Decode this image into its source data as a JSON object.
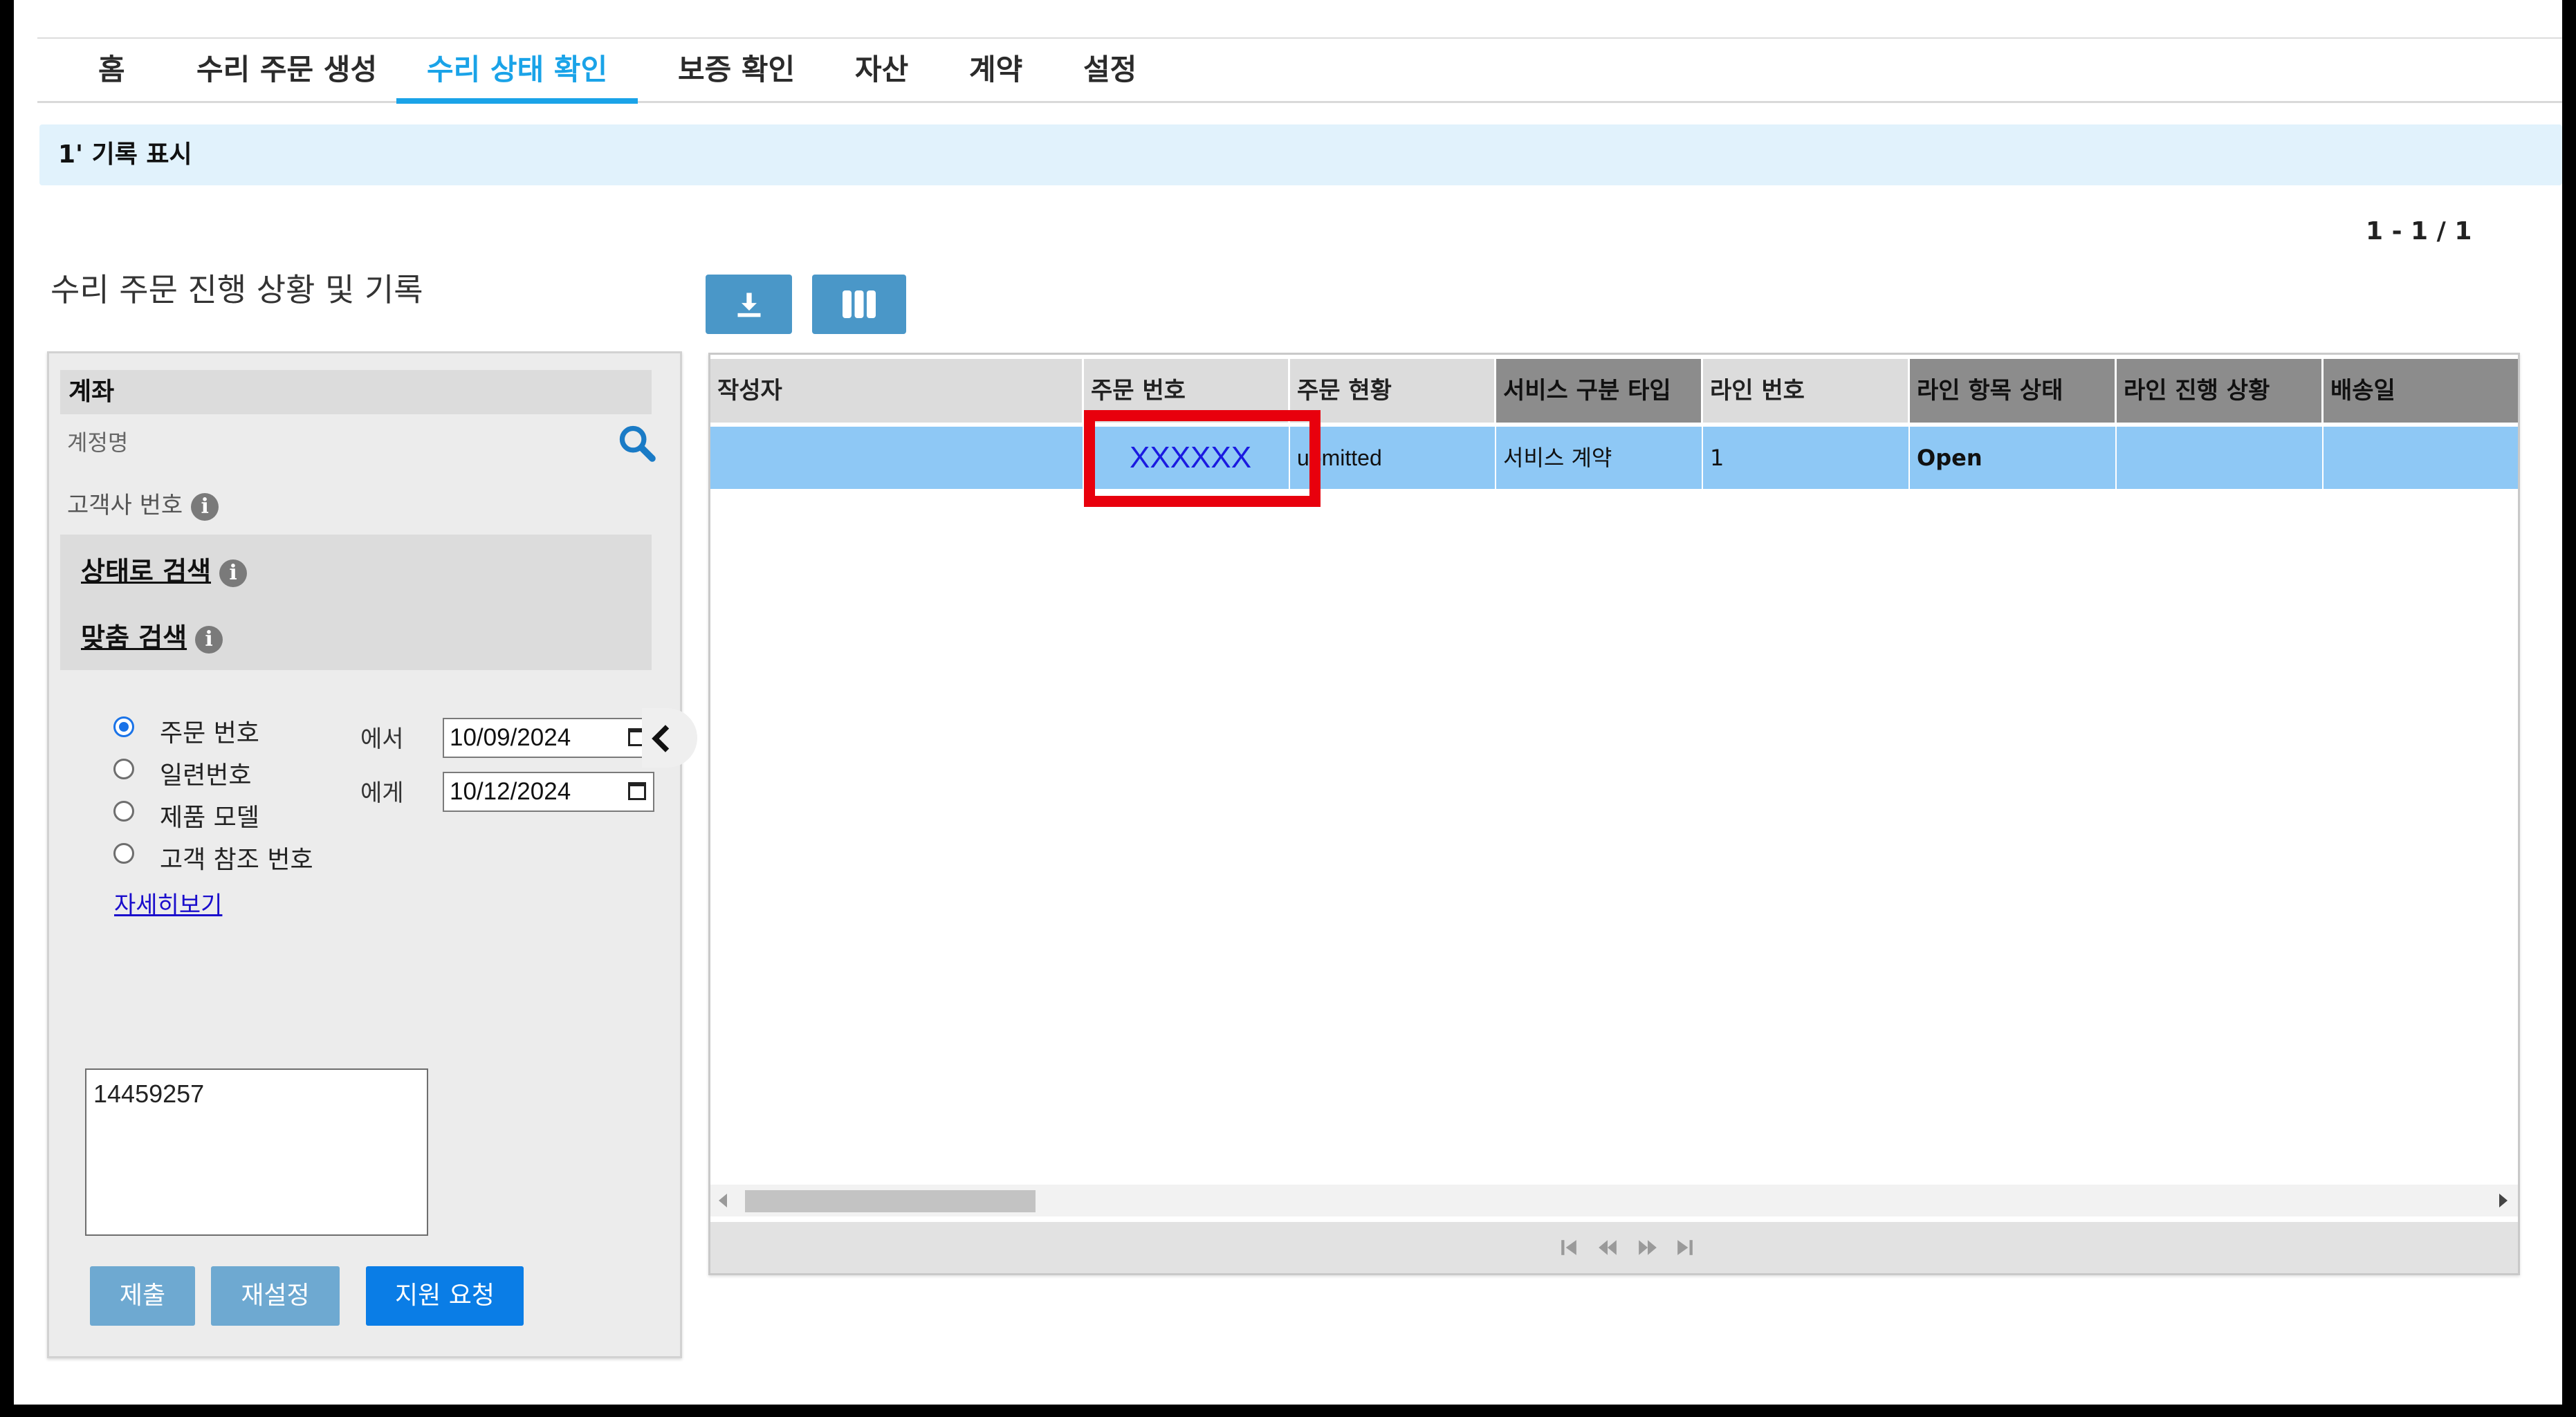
{
  "nav": {
    "tabs": [
      {
        "label": "홈"
      },
      {
        "label": "수리 주문 생성"
      },
      {
        "label": "수리 상태 확인"
      },
      {
        "label": "보증 확인"
      },
      {
        "label": "자산"
      },
      {
        "label": "계약"
      },
      {
        "label": "설정"
      }
    ]
  },
  "info_bar": {
    "text": "1' 기록 표시"
  },
  "pager": {
    "top": "1 - 1 / 1"
  },
  "panel_title": "수리 주문 진행 상황 및 기록",
  "toolbar": {
    "download_icon": "download-icon",
    "columns_icon": "columns-icon"
  },
  "filter": {
    "account_header": "계좌",
    "account_name_label": "계정명",
    "customer_number_label": "고객사 번호",
    "search_by_status": "상태로 검색",
    "custom_search": "맞춤 검색",
    "radio_options": [
      {
        "label": "주문 번호",
        "checked": true
      },
      {
        "label": "일련번호",
        "checked": false
      },
      {
        "label": "제품 모델",
        "checked": false
      },
      {
        "label": "고객 참조 번호",
        "checked": false
      }
    ],
    "more_link": "자세히보기",
    "from_label": "에서",
    "to_label": "에게",
    "from_date": "10/09/2024",
    "to_date": "10/12/2024",
    "textarea_value": "14459257",
    "buttons": {
      "submit": "제출",
      "reset": "재설정",
      "support": "지원 요청"
    }
  },
  "grid": {
    "columns": [
      "작성자",
      "주문 번호",
      "주문 현황",
      "서비스 구분 타입",
      "라인 번호",
      "라인 항목 상태",
      "라인 진행 상황",
      "배송일"
    ],
    "rows": [
      [
        "",
        "XXXXXX",
        "ubmitted",
        "서비스 계약",
        "1",
        "Open",
        "",
        ""
      ]
    ]
  },
  "colors": {
    "accent": "#1aa3e8",
    "row_selected": "#8ec8f5",
    "button": "#4a97c8",
    "primary_button": "#0a7de6",
    "highlight": "#e8000d"
  }
}
